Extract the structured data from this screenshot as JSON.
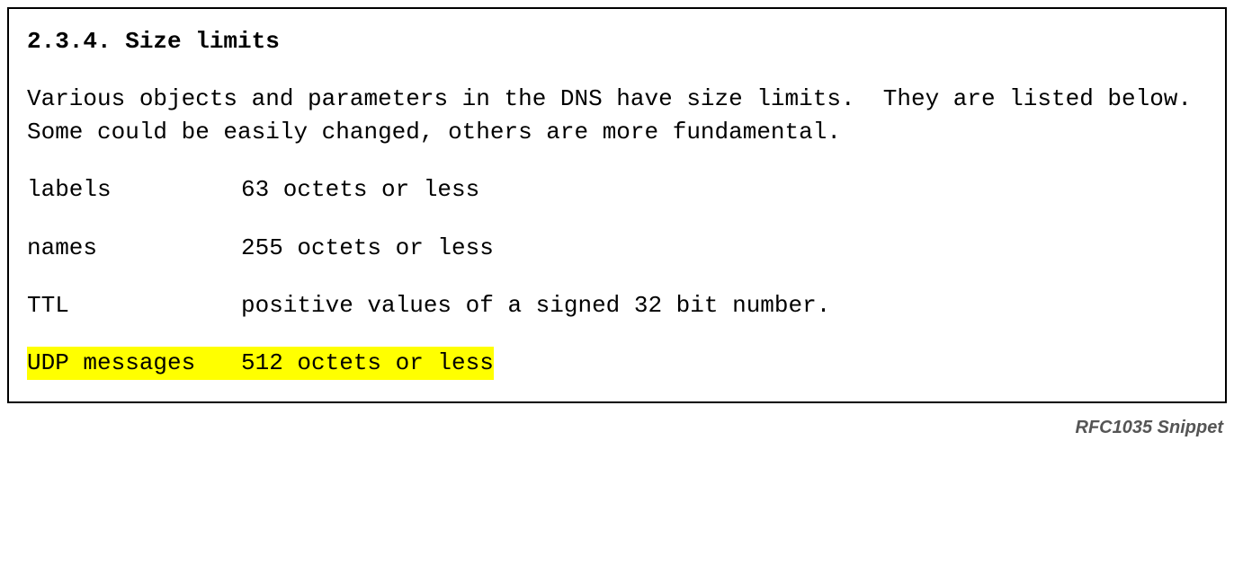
{
  "heading": "2.3.4. Size limits",
  "paragraph": "Various objects and parameters in the DNS have size limits.  They are listed below.  Some could be easily changed, others are more fundamental.",
  "rows": [
    {
      "term": "labels",
      "def": "63 octets or less",
      "highlight": false
    },
    {
      "term": "names",
      "def": "255 octets or less",
      "highlight": false
    },
    {
      "term": "TTL",
      "def": "positive values of a signed 32 bit number.",
      "highlight": false
    },
    {
      "term": "UDP messages",
      "def": "512 octets or less",
      "highlight": true
    }
  ],
  "caption": "RFC1035 Snippet"
}
